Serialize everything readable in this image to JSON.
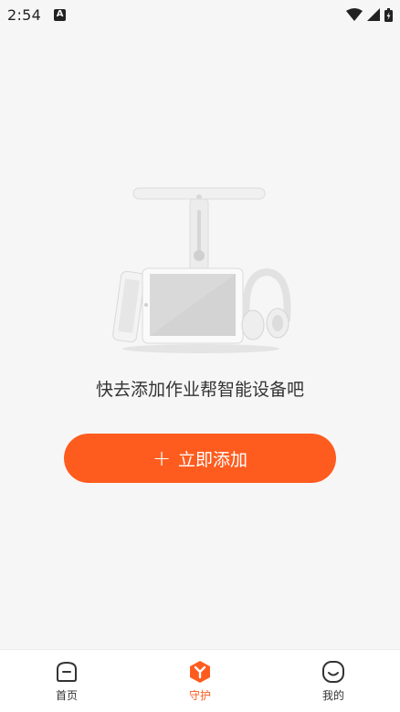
{
  "status_bar": {
    "time": "2:54",
    "notification_glyph": "A"
  },
  "empty_state": {
    "message": "快去添加作业帮智能设备吧",
    "add_button_label": "立即添加",
    "illustration": "smart-devices-illustration"
  },
  "colors": {
    "accent": "#fe5c1f",
    "background": "#f6f6f6"
  },
  "tab_bar": {
    "items": [
      {
        "label": "首页",
        "icon": "home-icon",
        "active": false
      },
      {
        "label": "守护",
        "icon": "guard-icon",
        "active": true
      },
      {
        "label": "我的",
        "icon": "profile-icon",
        "active": false
      }
    ]
  }
}
